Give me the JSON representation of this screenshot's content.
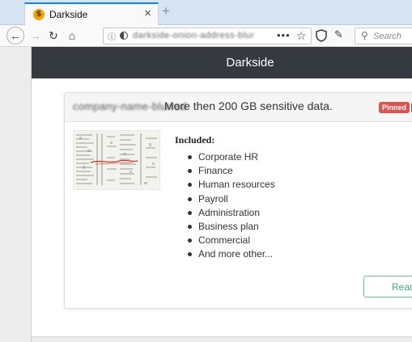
{
  "browser": {
    "tab": {
      "title": "Darkside",
      "favicon": "$",
      "close_glyph": "×"
    },
    "new_tab_glyph": "+",
    "toolbar": {
      "back_glyph": "←",
      "forward_glyph": "→",
      "reload_glyph": "↻",
      "home_glyph": "⌂",
      "url_info_glyph": "ⓘ",
      "url_text": "darkside-onion-address-blurred",
      "page_actions_glyph": "•••",
      "bookmark_glyph": "☆",
      "tracking_glyph": "✎",
      "search_icon": "⚲",
      "search_placeholder": "Search"
    }
  },
  "site": {
    "title": "Darkside"
  },
  "post": {
    "victim_name": "company-name-blurred",
    "title": "More then 200 GB sensitive data.",
    "badge": "Pinned",
    "included_label": "Included:",
    "items": [
      "Corporate HR",
      "Finance",
      "Human resources",
      "Payroll",
      "Administration",
      "Business plan",
      "Commercial",
      "And more other..."
    ],
    "read_button": "Read"
  },
  "colors": {
    "header_bg": "#343a40",
    "badge_red": "#d9534f",
    "read_button_accent": "#4aa58a",
    "tab_accent": "#0a84ff"
  }
}
